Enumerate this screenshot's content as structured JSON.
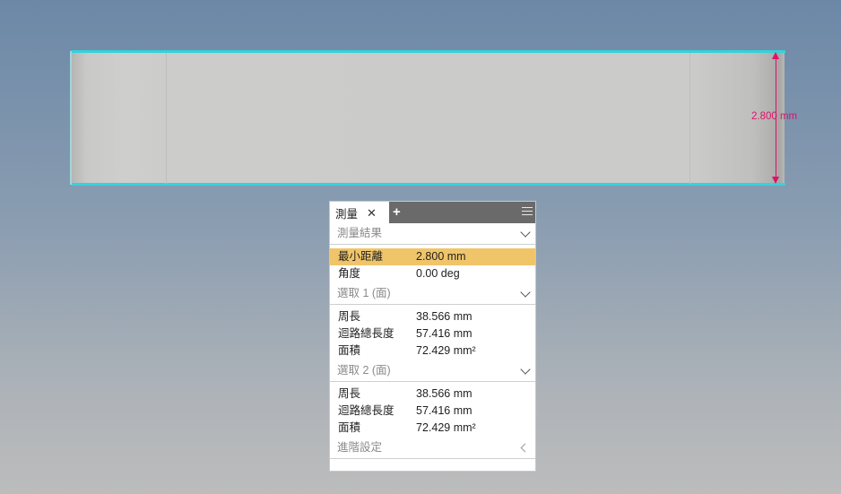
{
  "viewport": {
    "dimension_label": "2.800 mm",
    "colors": {
      "highlight_edge": "#34d2dc",
      "dimension": "#e0116a"
    }
  },
  "panel": {
    "tab_label": "測量",
    "icons": {
      "close": "close-icon",
      "add": "add-tab-icon",
      "menu": "menu-icon"
    },
    "sections": {
      "results": {
        "title": "測量結果",
        "rows": [
          {
            "label": "最小距離",
            "value": "2.800 mm"
          },
          {
            "label": "角度",
            "value": "0.00 deg"
          }
        ]
      },
      "selection1": {
        "title": "選取 1 (面)",
        "rows": [
          {
            "label": "周長",
            "value": "38.566 mm"
          },
          {
            "label": "迴路總長度",
            "value": "57.416 mm"
          },
          {
            "label": "面積",
            "value": "72.429 mm²"
          }
        ]
      },
      "selection2": {
        "title": "選取 2 (面)",
        "rows": [
          {
            "label": "周長",
            "value": "38.566 mm"
          },
          {
            "label": "迴路總長度",
            "value": "57.416 mm"
          },
          {
            "label": "面積",
            "value": "72.429 mm²"
          }
        ]
      },
      "advanced": {
        "title": "進階設定"
      }
    },
    "highlight_color": "#f0c56a"
  }
}
